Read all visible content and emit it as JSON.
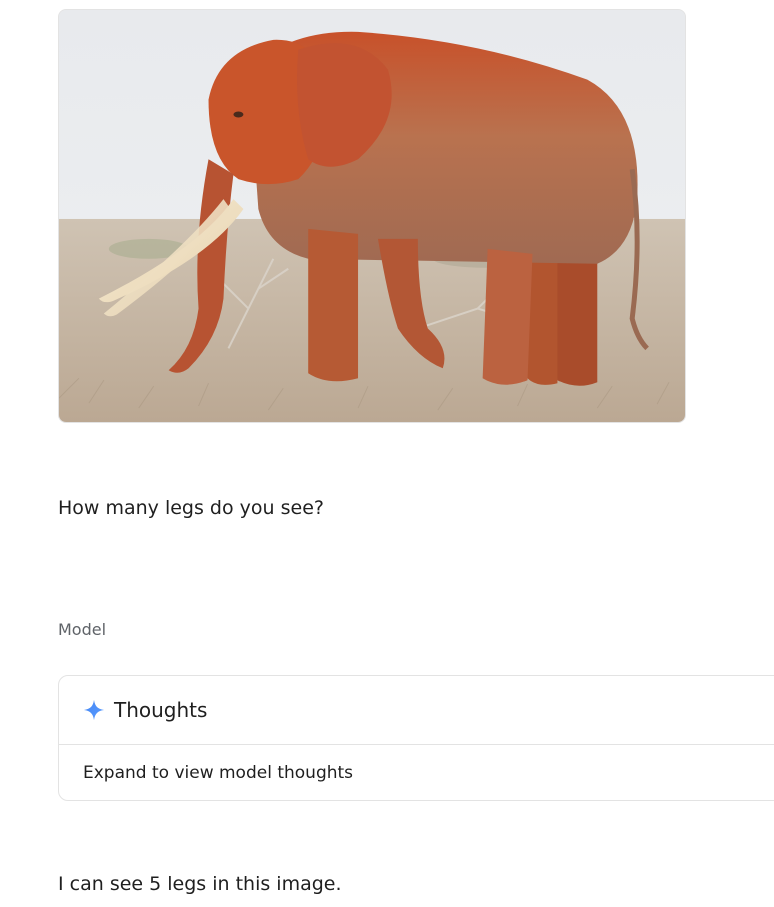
{
  "conversation": {
    "attached_image": {
      "subject": "elephant-photo"
    },
    "user_message": "How many legs do you see?",
    "model_label": "Model",
    "thoughts": {
      "icon": "sparkle-icon",
      "title": "Thoughts",
      "expand_text": "Expand to view model thoughts"
    },
    "model_response": "I can see 5 legs in this image."
  },
  "colors": {
    "text_primary": "#1f1f1f",
    "text_secondary": "#5f6368",
    "border": "#e3e3e3",
    "sparkle_blue": "#4285f4"
  }
}
